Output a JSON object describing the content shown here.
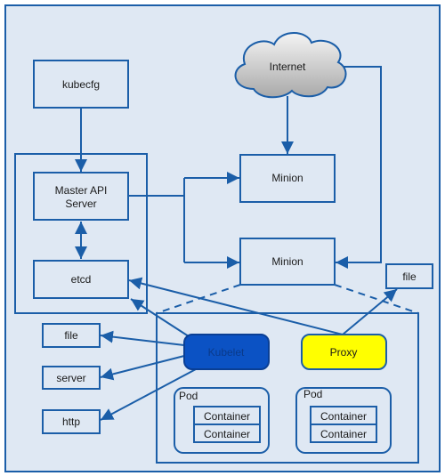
{
  "colors": {
    "line": "#1b5ea8",
    "background": "#dfe8f3",
    "kubelet": "#0b52c4",
    "proxy": "#ffff00"
  },
  "nodes": {
    "internet": "Internet",
    "kubecfg": "kubecfg",
    "master_api_line1": "Master API",
    "master_api_line2": "Server",
    "etcd": "etcd",
    "minion1": "Minion",
    "minion2": "Minion",
    "file_right": "file",
    "kubelet": "Kubelet",
    "proxy": "Proxy",
    "file_left": "file",
    "server": "server",
    "http": "http",
    "pod1": {
      "label": "Pod",
      "containers": [
        "Container",
        "Container"
      ]
    },
    "pod2": {
      "label": "Pod",
      "containers": [
        "Container",
        "Container"
      ]
    }
  }
}
